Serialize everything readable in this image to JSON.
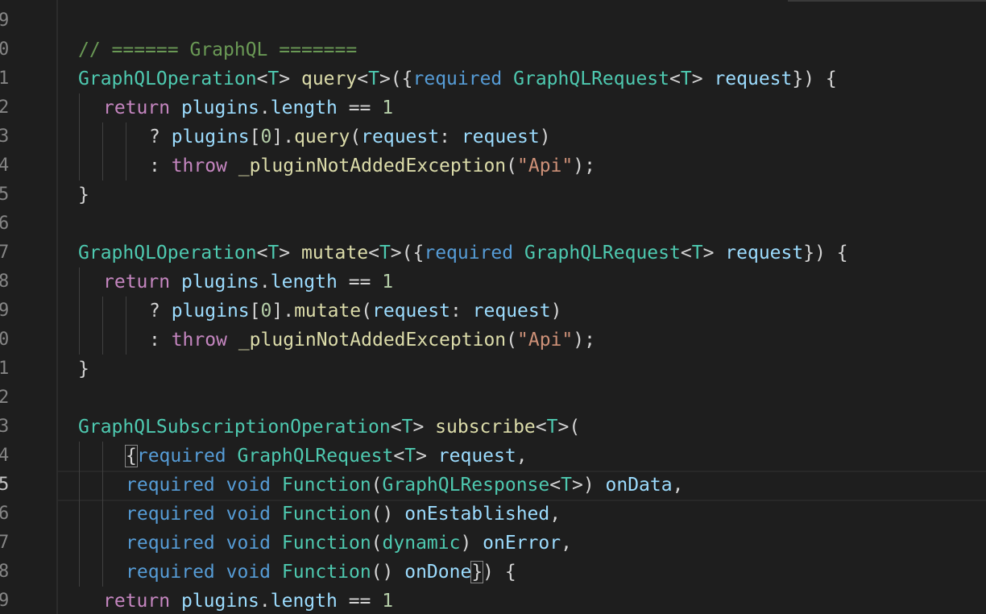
{
  "editor": {
    "line_numbers": [
      "9",
      "0",
      "1",
      "2",
      "3",
      "4",
      "5",
      "6",
      "7",
      "8",
      "9",
      "0",
      "1",
      "2",
      "3",
      "4",
      "5",
      "6",
      "7",
      "8",
      "9"
    ],
    "active_line_index": 16,
    "lines": [
      [],
      [
        [
          "// ====== GraphQL =======",
          "c-comment"
        ]
      ],
      [
        [
          "GraphQLOperation",
          "c-type"
        ],
        [
          "<",
          "c-punc"
        ],
        [
          "T",
          "c-type"
        ],
        [
          "> ",
          "c-punc"
        ],
        [
          "query",
          "c-fn"
        ],
        [
          "<",
          "c-punc"
        ],
        [
          "T",
          "c-type"
        ],
        [
          ">({",
          "c-punc"
        ],
        [
          "required",
          "c-kw"
        ],
        [
          " ",
          "c-punc"
        ],
        [
          "GraphQLRequest",
          "c-type"
        ],
        [
          "<",
          "c-punc"
        ],
        [
          "T",
          "c-type"
        ],
        [
          "> ",
          "c-punc"
        ],
        [
          "request",
          "c-var"
        ],
        [
          "}) {",
          "c-punc"
        ]
      ],
      [
        [
          "return",
          "c-ctrl"
        ],
        [
          " ",
          "c-punc"
        ],
        [
          "plugins",
          "c-var"
        ],
        [
          ".",
          "c-punc"
        ],
        [
          "length",
          "c-var"
        ],
        [
          " == ",
          "c-punc"
        ],
        [
          "1",
          "c-num"
        ]
      ],
      [
        [
          "? ",
          "c-punc"
        ],
        [
          "plugins",
          "c-var"
        ],
        [
          "[",
          "c-punc"
        ],
        [
          "0",
          "c-num"
        ],
        [
          "].",
          "c-punc"
        ],
        [
          "query",
          "c-fn"
        ],
        [
          "(",
          "c-punc"
        ],
        [
          "request",
          "c-var"
        ],
        [
          ": ",
          "c-punc"
        ],
        [
          "request",
          "c-var"
        ],
        [
          ")",
          "c-punc"
        ]
      ],
      [
        [
          ": ",
          "c-punc"
        ],
        [
          "throw",
          "c-ctrl"
        ],
        [
          " ",
          "c-punc"
        ],
        [
          "_pluginNotAddedException",
          "c-fn"
        ],
        [
          "(",
          "c-punc"
        ],
        [
          "\"Api\"",
          "c-str"
        ],
        [
          ");",
          "c-punc"
        ]
      ],
      [
        [
          "}",
          "c-punc"
        ]
      ],
      [],
      [
        [
          "GraphQLOperation",
          "c-type"
        ],
        [
          "<",
          "c-punc"
        ],
        [
          "T",
          "c-type"
        ],
        [
          "> ",
          "c-punc"
        ],
        [
          "mutate",
          "c-fn"
        ],
        [
          "<",
          "c-punc"
        ],
        [
          "T",
          "c-type"
        ],
        [
          ">({",
          "c-punc"
        ],
        [
          "required",
          "c-kw"
        ],
        [
          " ",
          "c-punc"
        ],
        [
          "GraphQLRequest",
          "c-type"
        ],
        [
          "<",
          "c-punc"
        ],
        [
          "T",
          "c-type"
        ],
        [
          "> ",
          "c-punc"
        ],
        [
          "request",
          "c-var"
        ],
        [
          "}) {",
          "c-punc"
        ]
      ],
      [
        [
          "return",
          "c-ctrl"
        ],
        [
          " ",
          "c-punc"
        ],
        [
          "plugins",
          "c-var"
        ],
        [
          ".",
          "c-punc"
        ],
        [
          "length",
          "c-var"
        ],
        [
          " == ",
          "c-punc"
        ],
        [
          "1",
          "c-num"
        ]
      ],
      [
        [
          "? ",
          "c-punc"
        ],
        [
          "plugins",
          "c-var"
        ],
        [
          "[",
          "c-punc"
        ],
        [
          "0",
          "c-num"
        ],
        [
          "].",
          "c-punc"
        ],
        [
          "mutate",
          "c-fn"
        ],
        [
          "(",
          "c-punc"
        ],
        [
          "request",
          "c-var"
        ],
        [
          ": ",
          "c-punc"
        ],
        [
          "request",
          "c-var"
        ],
        [
          ")",
          "c-punc"
        ]
      ],
      [
        [
          ": ",
          "c-punc"
        ],
        [
          "throw",
          "c-ctrl"
        ],
        [
          " ",
          "c-punc"
        ],
        [
          "_pluginNotAddedException",
          "c-fn"
        ],
        [
          "(",
          "c-punc"
        ],
        [
          "\"Api\"",
          "c-str"
        ],
        [
          ");",
          "c-punc"
        ]
      ],
      [
        [
          "}",
          "c-punc"
        ]
      ],
      [],
      [
        [
          "GraphQLSubscriptionOperation",
          "c-type"
        ],
        [
          "<",
          "c-punc"
        ],
        [
          "T",
          "c-type"
        ],
        [
          "> ",
          "c-punc"
        ],
        [
          "subscribe",
          "c-fn"
        ],
        [
          "<",
          "c-punc"
        ],
        [
          "T",
          "c-type"
        ],
        [
          ">(",
          "c-punc"
        ]
      ],
      [
        [
          "{",
          "c-punc"
        ],
        [
          "required",
          "c-kw"
        ],
        [
          " ",
          "c-punc"
        ],
        [
          "GraphQLRequest",
          "c-type"
        ],
        [
          "<",
          "c-punc"
        ],
        [
          "T",
          "c-type"
        ],
        [
          "> ",
          "c-punc"
        ],
        [
          "request",
          "c-var"
        ],
        [
          ",",
          "c-punc"
        ]
      ],
      [
        [
          "required",
          "c-kw"
        ],
        [
          " ",
          "c-punc"
        ],
        [
          "void",
          "c-kw"
        ],
        [
          " ",
          "c-punc"
        ],
        [
          "Function",
          "c-type"
        ],
        [
          "(",
          "c-punc"
        ],
        [
          "GraphQLResponse",
          "c-type"
        ],
        [
          "<",
          "c-punc"
        ],
        [
          "T",
          "c-type"
        ],
        [
          ">) ",
          "c-punc"
        ],
        [
          "onData",
          "c-var"
        ],
        [
          ",",
          "c-punc"
        ]
      ],
      [
        [
          "required",
          "c-kw"
        ],
        [
          " ",
          "c-punc"
        ],
        [
          "void",
          "c-kw"
        ],
        [
          " ",
          "c-punc"
        ],
        [
          "Function",
          "c-type"
        ],
        [
          "() ",
          "c-punc"
        ],
        [
          "onEstablished",
          "c-var"
        ],
        [
          ",",
          "c-punc"
        ]
      ],
      [
        [
          "required",
          "c-kw"
        ],
        [
          " ",
          "c-punc"
        ],
        [
          "void",
          "c-kw"
        ],
        [
          " ",
          "c-punc"
        ],
        [
          "Function",
          "c-type"
        ],
        [
          "(",
          "c-punc"
        ],
        [
          "dynamic",
          "c-type"
        ],
        [
          ") ",
          "c-punc"
        ],
        [
          "onError",
          "c-var"
        ],
        [
          ",",
          "c-punc"
        ]
      ],
      [
        [
          "required",
          "c-kw"
        ],
        [
          " ",
          "c-punc"
        ],
        [
          "void",
          "c-kw"
        ],
        [
          " ",
          "c-punc"
        ],
        [
          "Function",
          "c-type"
        ],
        [
          "() ",
          "c-punc"
        ],
        [
          "onDone",
          "c-var"
        ],
        [
          "}",
          "c-punc"
        ],
        [
          ") {",
          "c-punc"
        ]
      ],
      [
        [
          "return",
          "c-ctrl"
        ],
        [
          " ",
          "c-punc"
        ],
        [
          "plugins",
          "c-var"
        ],
        [
          ".",
          "c-punc"
        ],
        [
          "length",
          "c-var"
        ],
        [
          " == ",
          "c-punc"
        ],
        [
          "1",
          "c-num"
        ]
      ]
    ]
  }
}
